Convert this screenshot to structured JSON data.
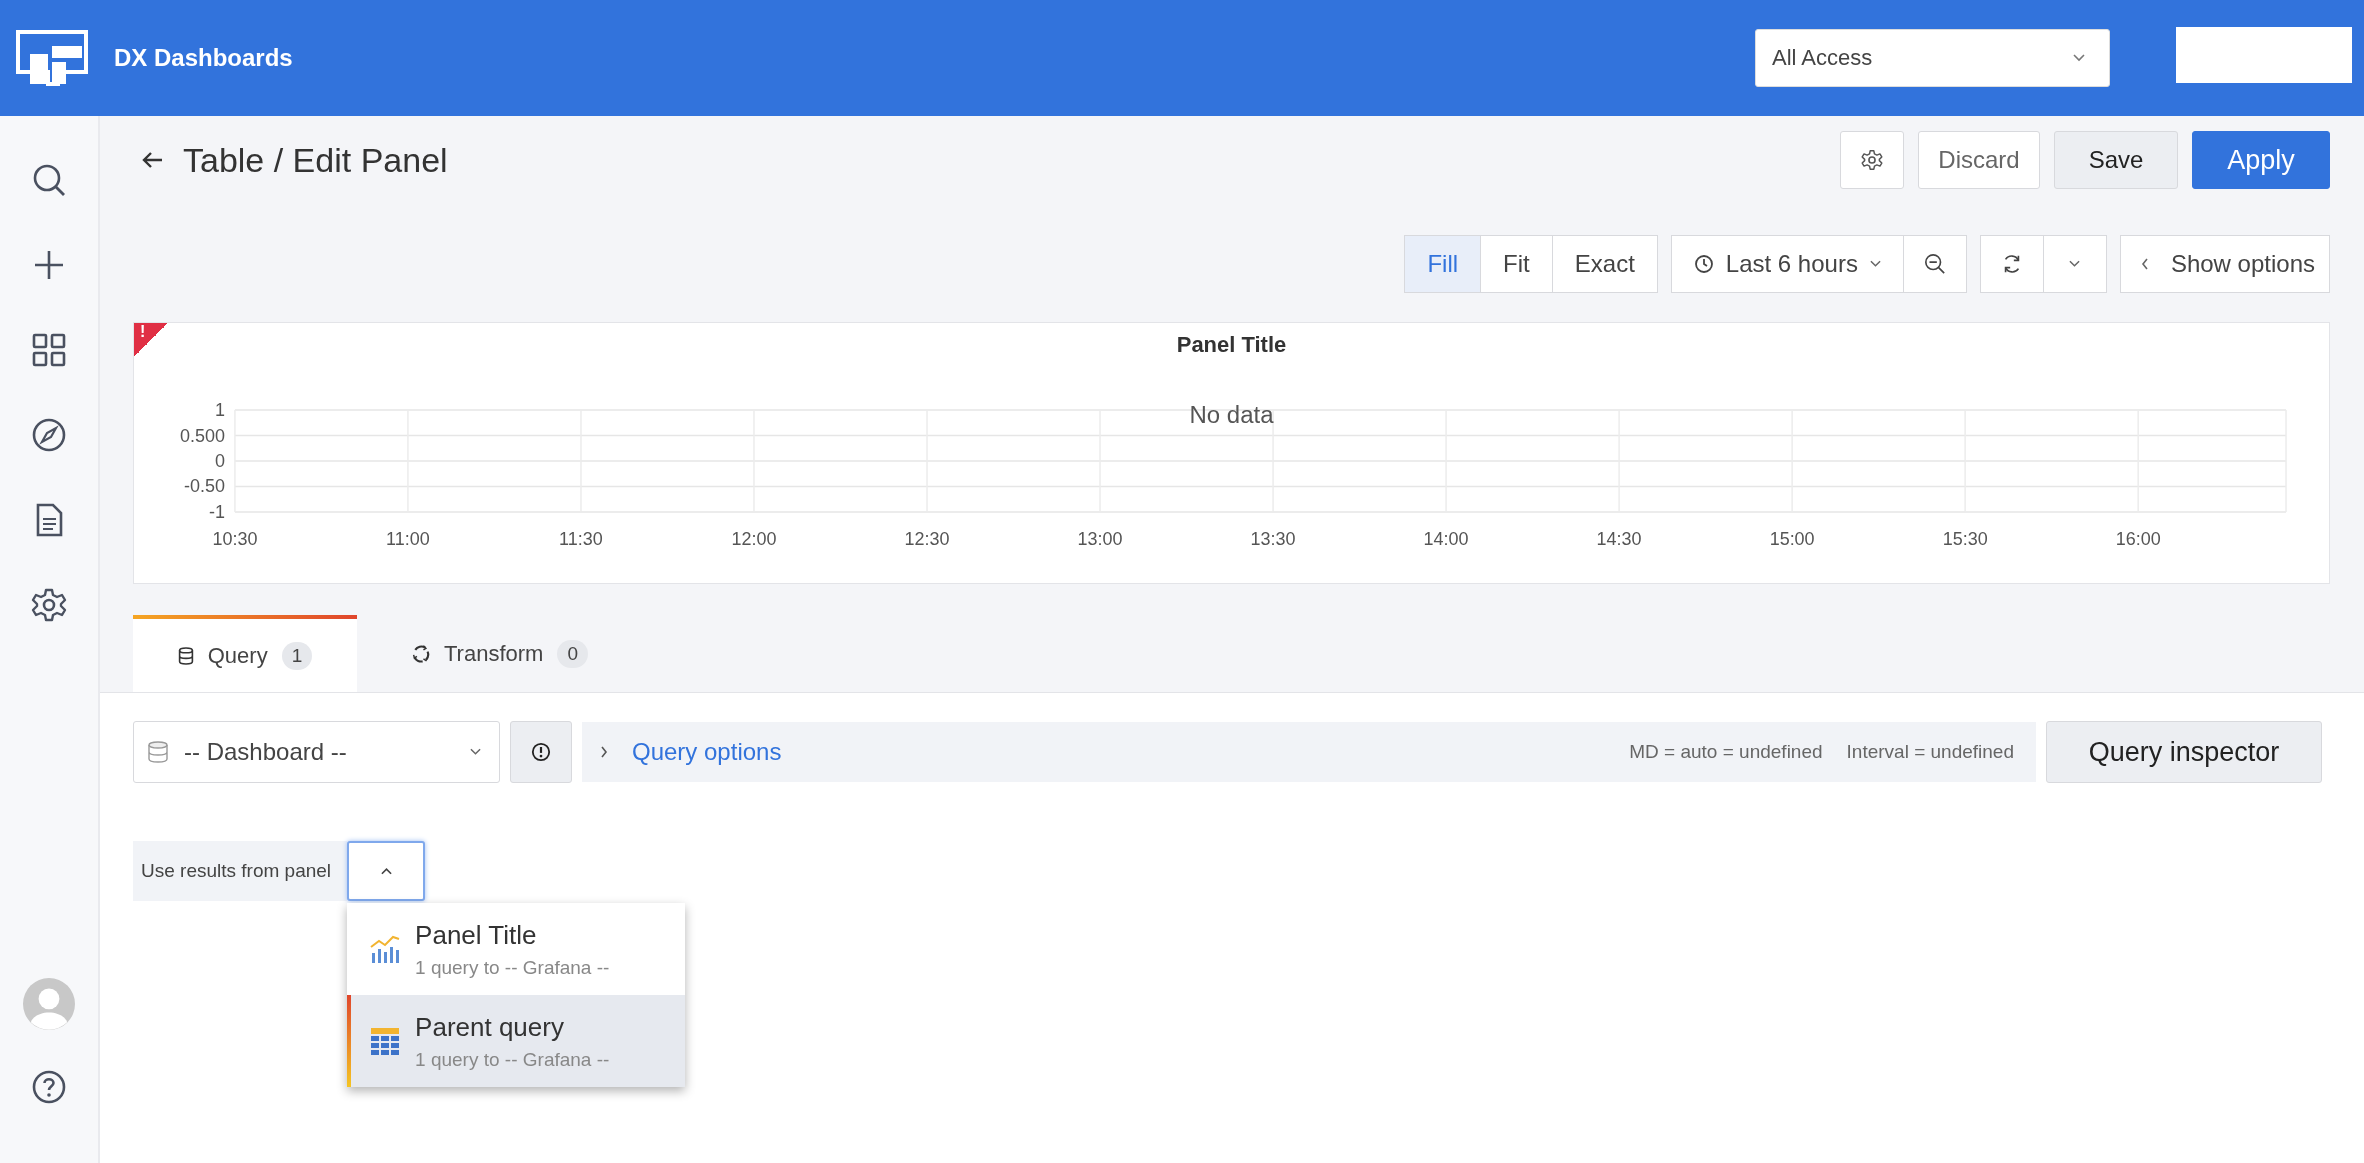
{
  "top_bar": {
    "brand": "DX Dashboards",
    "org_select": {
      "value": "All Access"
    }
  },
  "header": {
    "title": "Table / Edit Panel",
    "buttons": [
      {
        "label": "Discard",
        "kind": "ghost"
      },
      {
        "label": "Save",
        "kind": "secondary"
      },
      {
        "label": "Apply",
        "kind": "primary"
      }
    ]
  },
  "toolbar": {
    "view_modes": [
      {
        "label": "Fill",
        "selected": true
      },
      {
        "label": "Fit",
        "selected": false
      },
      {
        "label": "Exact",
        "selected": false
      }
    ],
    "time_range": "Last 6 hours",
    "show_options": "Show options"
  },
  "panel": {
    "error_badge": "!",
    "no_data": "No data",
    "chart_data": {
      "type": "line",
      "title": "Panel Title",
      "grid": true,
      "categories": [
        "10:30",
        "11:00",
        "11:30",
        "12:00",
        "12:30",
        "13:00",
        "13:30",
        "14:00",
        "14:30",
        "15:00",
        "15:30",
        "16:00"
      ],
      "yticks": [
        {
          "value": 1,
          "label": "1"
        },
        {
          "value": 0.5,
          "label": "0.500"
        },
        {
          "value": 0,
          "label": "0"
        },
        {
          "value": -0.5,
          "label": "-0.50"
        },
        {
          "value": -1,
          "label": "-1"
        }
      ],
      "ylim": [
        -1,
        1
      ]
    }
  },
  "tabs": [
    {
      "label": "Query",
      "count": "1",
      "selected": true
    },
    {
      "label": "Transform",
      "count": "0",
      "selected": false
    }
  ],
  "query_row": {
    "datasource": "-- Dashboard --",
    "options_label": "Query options",
    "md": "MD = auto = undefined",
    "interval": "Interval = undefined",
    "inspector": "Query inspector"
  },
  "panel_select": {
    "label": "Use results from panel",
    "expanded": true,
    "options": [
      {
        "title": "Panel Title",
        "subtitle": "1 query to -- Grafana --",
        "kind": "graph",
        "selected": false
      },
      {
        "title": "Parent query",
        "subtitle": "1 query to -- Grafana --",
        "kind": "table",
        "selected": true
      }
    ]
  }
}
